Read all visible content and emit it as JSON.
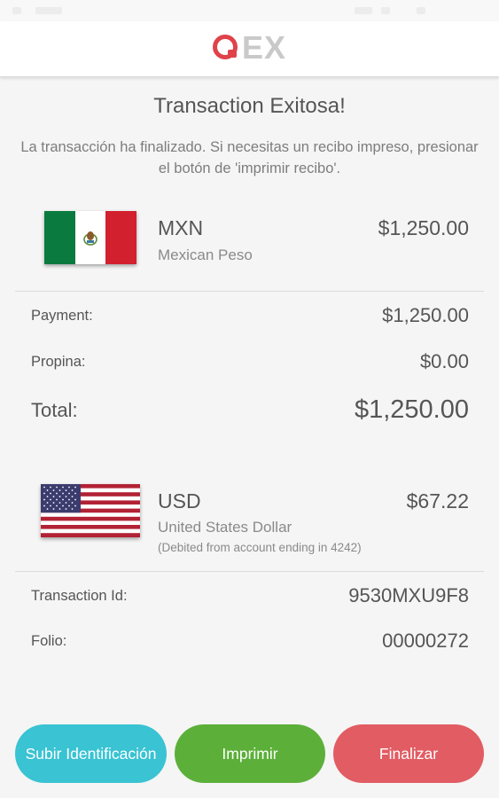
{
  "app": {
    "logo_text": "EX",
    "brand_color": "#e0424a"
  },
  "receipt": {
    "title": "Transaction Exitosa!",
    "message": "La transacción ha finalizado. Si necesitas un recibo impreso, presionar el botón de 'imprimir recibo'."
  },
  "source_currency": {
    "flag_icon": "mexico-flag-icon",
    "code": "MXN",
    "name": "Mexican Peso",
    "amount": "$1,250.00"
  },
  "summary": {
    "payment_label": "Payment:",
    "payment_value": "$1,250.00",
    "tip_label": "Propina:",
    "tip_value": "$0.00",
    "total_label": "Total:",
    "total_value": "$1,250.00"
  },
  "target_currency": {
    "flag_icon": "usa-flag-icon",
    "code": "USD",
    "name": "United States Dollar",
    "amount": "$67.22",
    "debit_note": "(Debited from account ending in 4242)"
  },
  "details": {
    "transaction_id_label": "Transaction Id:",
    "transaction_id_value": "9530MXU9F8",
    "folio_label": "Folio:",
    "folio_value": "00000272"
  },
  "actions": {
    "upload_label": "Subir Identificación",
    "print_label": "Imprimir",
    "finish_label": "Finalizar",
    "upload_color": "#39c3d3",
    "print_color": "#5cb039",
    "finish_color": "#e25c63"
  }
}
